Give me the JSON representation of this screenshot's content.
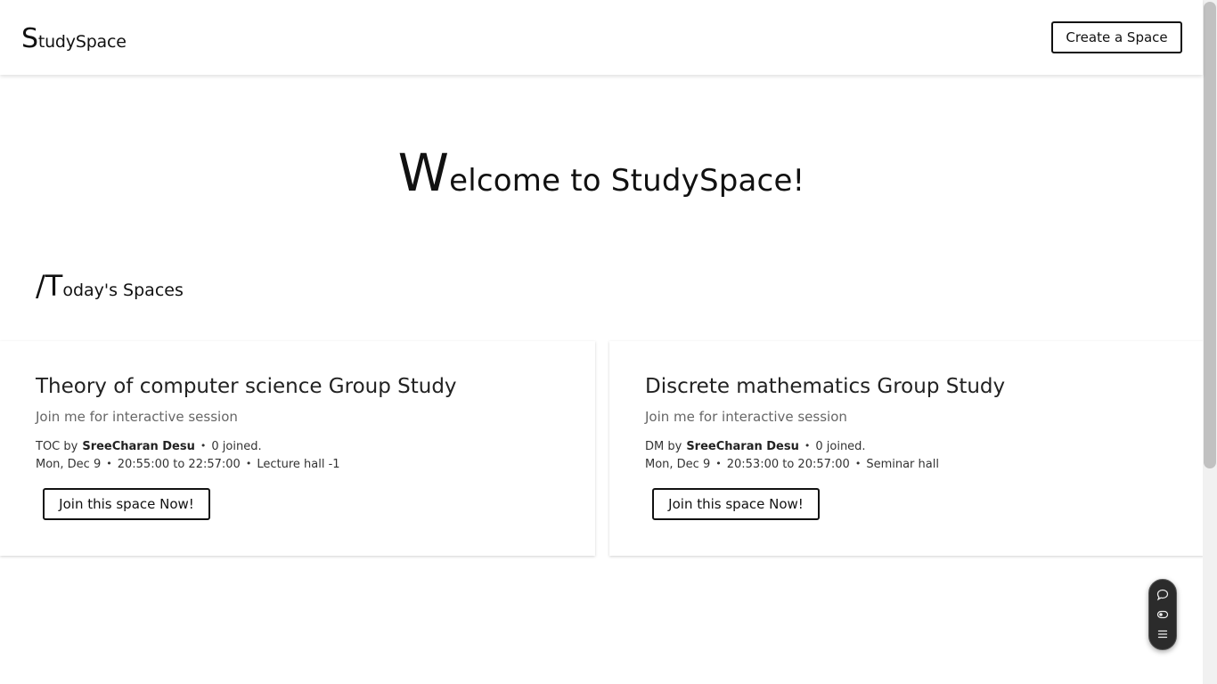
{
  "header": {
    "logo_initial": "S",
    "logo_rest": "tudySpace",
    "create_button": "Create a Space"
  },
  "welcome": {
    "initial": "W",
    "rest": "elcome to StudySpace!"
  },
  "section": {
    "prefix": "/T",
    "rest": "oday's Spaces"
  },
  "spaces": [
    {
      "title": "Theory of computer science Group Study",
      "subtitle": "Join me for interactive session",
      "code_by": "TOC by",
      "host": "SreeCharan Desu",
      "joined": "0 joined.",
      "date": "Mon, Dec 9",
      "time": "20:55:00 to 22:57:00",
      "location": "Lecture hall -1",
      "join_button": "Join this space Now!"
    },
    {
      "title": "Discrete mathematics Group Study",
      "subtitle": "Join me for interactive session",
      "code_by": "DM by",
      "host": "SreeCharan Desu",
      "joined": "0 joined.",
      "date": "Mon, Dec 9",
      "time": "20:53:00 to 20:57:00",
      "location": "Seminar hall",
      "join_button": "Join this space Now!"
    }
  ],
  "floating_toolbar": {
    "icons": [
      "chat-bubble-icon",
      "toggle-icon",
      "menu-icon"
    ]
  },
  "separator": "•"
}
